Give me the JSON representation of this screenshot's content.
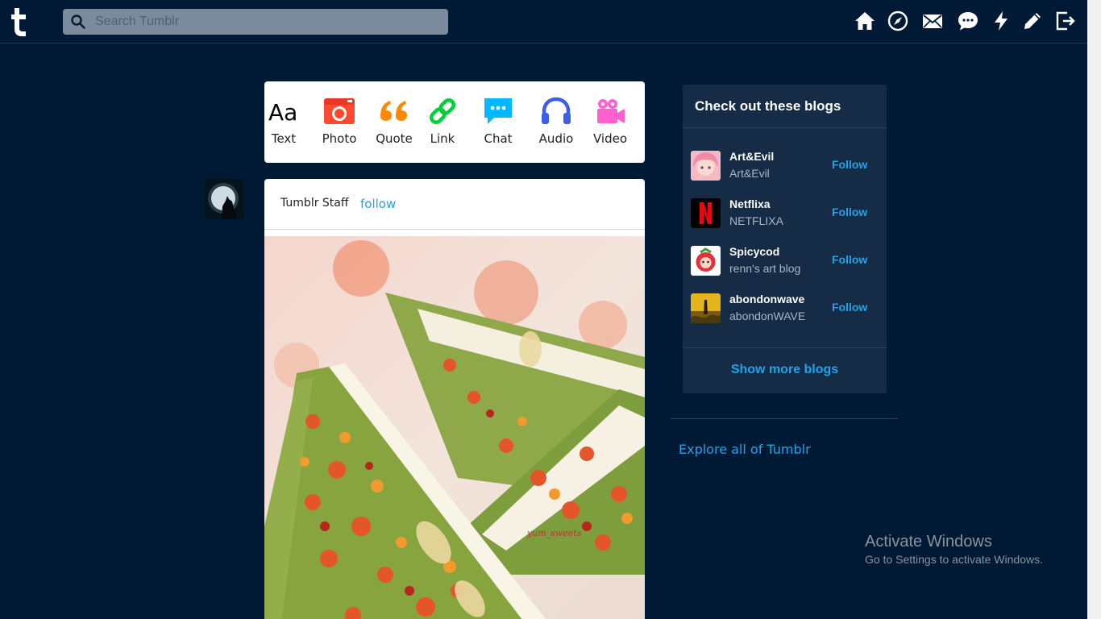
{
  "header": {
    "search": {
      "placeholder": "Search Tumblr",
      "value": ""
    },
    "nav_icons": [
      "home-icon",
      "explore-icon",
      "inbox-icon",
      "messages-icon",
      "activity-icon",
      "compose-icon",
      "logout-icon"
    ]
  },
  "compose": {
    "types": [
      {
        "label": "Text",
        "icon": "text-icon",
        "color": "#000000"
      },
      {
        "label": "Photo",
        "icon": "camera-icon",
        "color": "#ff4930"
      },
      {
        "label": "Quote",
        "icon": "quote-icon",
        "color": "#ff8a00"
      },
      {
        "label": "Link",
        "icon": "link-icon",
        "color": "#00cf35"
      },
      {
        "label": "Chat",
        "icon": "chat-icon",
        "color": "#00b8ff"
      },
      {
        "label": "Audio",
        "icon": "headphones-icon",
        "color": "#7c5cff"
      },
      {
        "label": "Video",
        "icon": "video-camera-icon",
        "color": "#ff62ce"
      }
    ]
  },
  "post": {
    "author": "Tumblr Staff",
    "follow_label": "follow",
    "image_watermark": "yum_sweets"
  },
  "sidebar": {
    "title": "Check out these blogs",
    "blogs": [
      {
        "name": "Art&Evil",
        "subtitle": "Art&Evil",
        "follow_label": "Follow"
      },
      {
        "name": "Netflixa",
        "subtitle": "NETFLIXA",
        "follow_label": "Follow"
      },
      {
        "name": "Spicycod",
        "subtitle": "renn's art blog",
        "follow_label": "Follow"
      },
      {
        "name": "abondonwave",
        "subtitle": "abondonWAVE",
        "follow_label": "Follow"
      }
    ],
    "show_more": "Show more blogs",
    "explore": "Explore all of Tumblr"
  },
  "system": {
    "activation_title": "Activate Windows",
    "activation_text": "Go to Settings to activate Windows."
  },
  "colors": {
    "background": "#001935",
    "accent": "#1fa4e8",
    "panel": "#152b46"
  }
}
